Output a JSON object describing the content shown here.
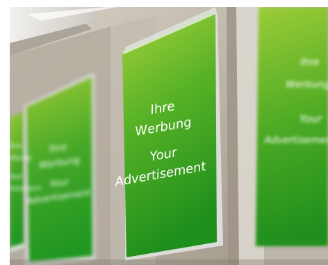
{
  "scene": {
    "description_lines": []
  },
  "posters": [
    {
      "line1": "Ihre",
      "line2": "Werbung",
      "line3": "Your",
      "line4": "Advertisement"
    },
    {
      "line1": "Ihre",
      "line2": "Werbung",
      "line3": "Your",
      "line4": "Advertisement"
    },
    {
      "line1": "Ihre",
      "line2": "Werbung",
      "line3": "Your",
      "line4": "Advertisement"
    },
    {
      "line1": "Ihre",
      "line2": "Werbung",
      "line3": "Your",
      "line4": "Advertisement"
    }
  ],
  "colors": {
    "poster_green_light": "#9bcb36",
    "poster_green_dark": "#2f9a1a",
    "wall": "#b8b2a7",
    "pillar": "#a79f93",
    "frame_silver": "#d9dad8"
  }
}
